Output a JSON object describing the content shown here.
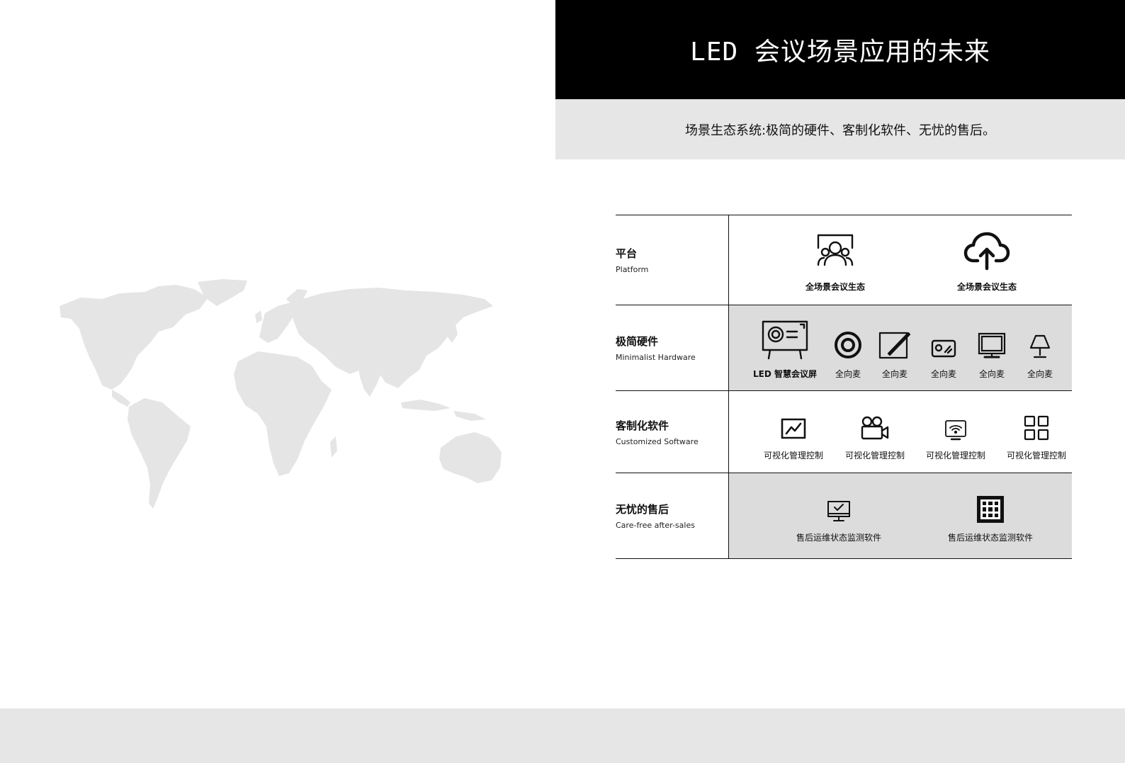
{
  "header": {
    "title": "LED 会议场景应用的未来"
  },
  "subtitle": "场景生态系统:极简的硬件、客制化软件、无忧的售后。",
  "rows": [
    {
      "label_cn": "平台",
      "label_en": "Platform",
      "items": [
        {
          "icon": "users-screen-icon",
          "caption": "全场景会议生态"
        },
        {
          "icon": "cloud-upload-icon",
          "caption": "全场景会议生态"
        }
      ]
    },
    {
      "label_cn": "极简硬件",
      "label_en": "Minimalist Hardware",
      "items": [
        {
          "icon": "led-display-icon",
          "caption": "LED 智慧会议屏"
        },
        {
          "icon": "omni-mic-icon",
          "caption": "全向麦"
        },
        {
          "icon": "pen-tablet-icon",
          "caption": "全向麦"
        },
        {
          "icon": "control-box-icon",
          "caption": "全向麦"
        },
        {
          "icon": "monitor-icon",
          "caption": "全向麦"
        },
        {
          "icon": "desk-lamp-icon",
          "caption": "全向麦"
        }
      ]
    },
    {
      "label_cn": "客制化软件",
      "label_en": "Customized Software",
      "items": [
        {
          "icon": "line-chart-icon",
          "caption": "可视化管理控制"
        },
        {
          "icon": "video-camera-icon",
          "caption": "可视化管理控制"
        },
        {
          "icon": "wifi-screen-icon",
          "caption": "可视化管理控制"
        },
        {
          "icon": "grid-apps-icon",
          "caption": "可视化管理控制"
        }
      ]
    },
    {
      "label_cn": "无忧的售后",
      "label_en": "Care-free after-sales",
      "items": [
        {
          "icon": "monitor-check-icon",
          "caption": "售后运维状态监测软件"
        },
        {
          "icon": "grid-panel-icon",
          "caption": "售后运维状态监测软件"
        }
      ]
    }
  ]
}
